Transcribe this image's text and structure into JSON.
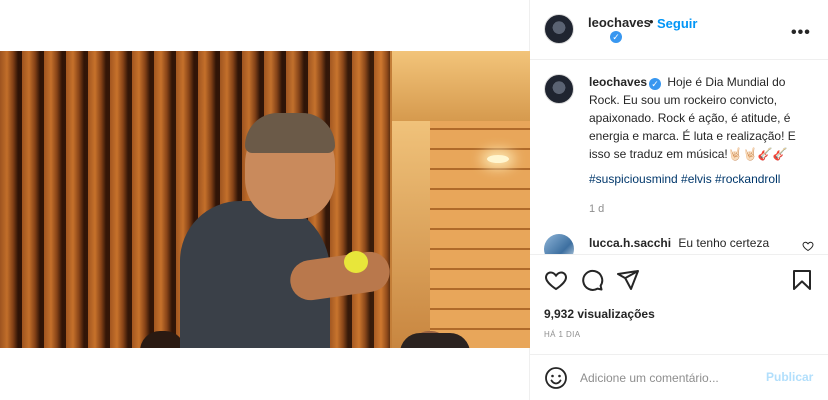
{
  "post": {
    "username": "leochaves",
    "follow_label": "Seguir",
    "dot": "•",
    "more_label": "•••",
    "verified_mark": "✓"
  },
  "caption": {
    "username": "leochaves",
    "text": "Hoje é Dia Mundial do Rock. Eu sou um rockeiro convicto, apaixonado. Rock é ação, é atitude, é energia e marca. É luta e realização! E isso se traduz em música!🤘🏻🤘🏻🎸🎸",
    "hashtags": "#suspiciousmind #elvis #rockandroll",
    "age": "1 d"
  },
  "comment": {
    "username": "lucca.h.sacchi",
    "text": "Eu tenho certeza"
  },
  "stats": {
    "views": "9,932 visualizações",
    "date": "HÁ 1 DIA"
  },
  "add_comment": {
    "placeholder": "Adicione um comentário...",
    "publish_label": "Publicar"
  },
  "colors": {
    "accent": "#0095f6",
    "verified": "#3897f0",
    "hashtag": "#00376b",
    "publish_disabled": "#b2dffc"
  },
  "icons": [
    "heart-icon",
    "comment-icon",
    "share-icon",
    "bookmark-icon",
    "emoji-icon",
    "more-icon",
    "verified-icon"
  ]
}
